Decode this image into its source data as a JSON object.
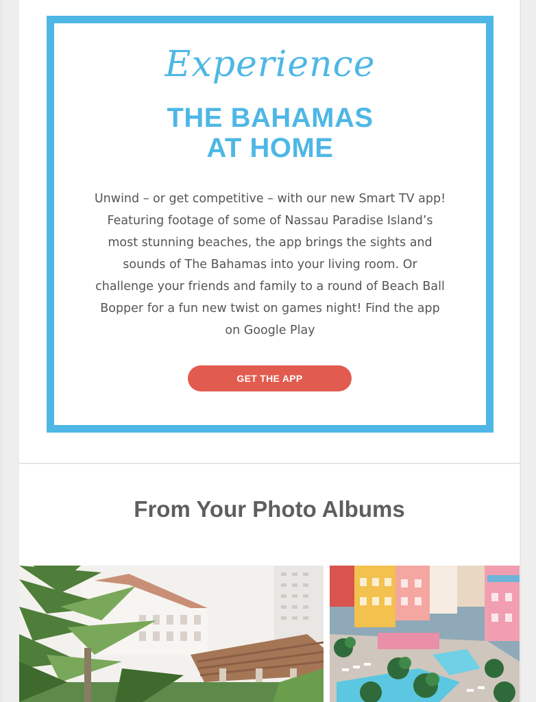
{
  "promo": {
    "script_title": "Experience",
    "headline_line1": "THE BAHAMAS",
    "headline_line2": "AT HOME",
    "body": "Unwind – or get competitive – with our new Smart TV app! Featuring footage of some of Nassau Paradise Island’s most stunning beaches, the app brings the sights and sounds of The Bahamas into your living room. Or challenge your friends and family to a round of Beach Ball Bopper for a fun new twist on games night! Find the app on Google Play",
    "cta_label": "GET THE APP"
  },
  "albums": {
    "heading": "From Your Photo Albums",
    "photos": [
      {
        "subject": "resort-palms-photo"
      },
      {
        "subject": "colorful-resort-pool-photo"
      }
    ]
  },
  "colors": {
    "accent_blue": "#4eb7e6",
    "cta_red": "#e25b4f",
    "heading_gray": "#5e5e5e",
    "text_gray": "#555555"
  }
}
